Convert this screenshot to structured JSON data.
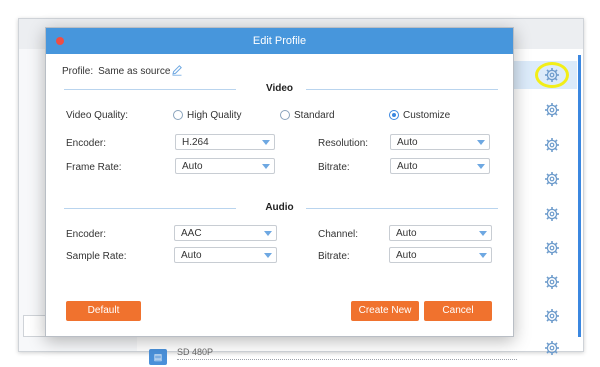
{
  "dialog": {
    "title": "Edit Profile",
    "profile_label": "Profile:",
    "profile_value": "Same as source"
  },
  "video": {
    "section_title": "Video",
    "quality_label": "Video Quality:",
    "quality_options": [
      "High Quality",
      "Standard",
      "Customize"
    ],
    "quality_selected": "Customize",
    "encoder_label": "Encoder:",
    "encoder_value": "H.264",
    "resolution_label": "Resolution:",
    "resolution_value": "Auto",
    "frame_rate_label": "Frame Rate:",
    "frame_rate_value": "Auto",
    "bitrate_label": "Bitrate:",
    "bitrate_value": "Auto"
  },
  "audio": {
    "section_title": "Audio",
    "encoder_label": "Encoder:",
    "encoder_value": "AAC",
    "channel_label": "Channel:",
    "channel_value": "Auto",
    "sample_rate_label": "Sample Rate:",
    "sample_rate_value": "Auto",
    "bitrate_label": "Bitrate:",
    "bitrate_value": "Auto"
  },
  "buttons": {
    "default_label": "Default",
    "create_new_label": "Create New",
    "cancel_label": "Cancel"
  },
  "background": {
    "list_footer_label": "SD 480P",
    "list_footer_icon": "video-file-icon",
    "row_action_icon": "gear-icon",
    "highlight_color": "#f2ee18"
  },
  "colors": {
    "titlebar": "#4796dc",
    "accent_button": "#f0722e",
    "close_dot": "#ee4e45"
  }
}
